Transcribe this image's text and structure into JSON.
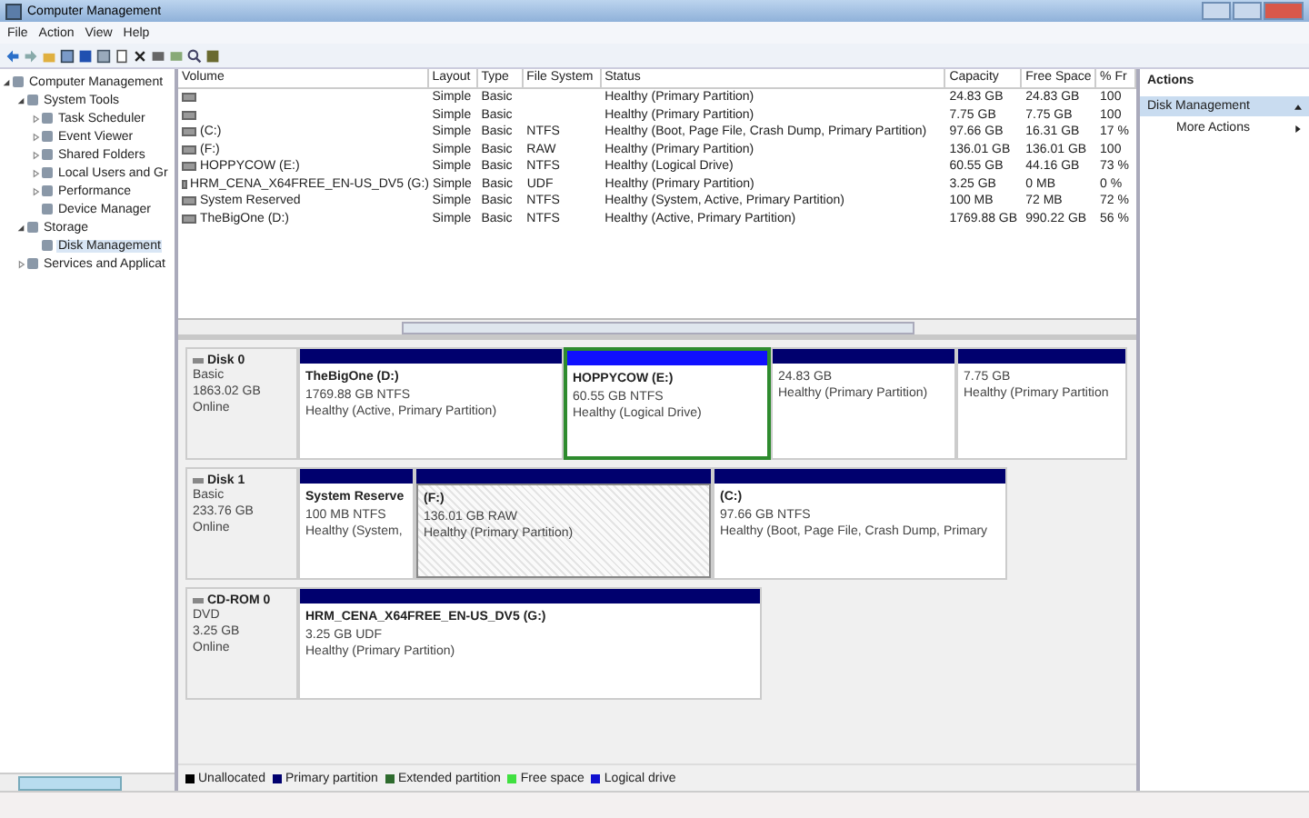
{
  "window": {
    "title": "Computer Management"
  },
  "menu": [
    "File",
    "Action",
    "View",
    "Help"
  ],
  "tree": [
    {
      "label": "Computer Management",
      "expanded": true,
      "children": [
        {
          "label": "System Tools",
          "expanded": true,
          "children": [
            {
              "label": "Task Scheduler",
              "expanded": false
            },
            {
              "label": "Event Viewer",
              "expanded": false
            },
            {
              "label": "Shared Folders",
              "expanded": false
            },
            {
              "label": "Local Users and Gr",
              "expanded": false
            },
            {
              "label": "Performance",
              "expanded": false
            },
            {
              "label": "Device Manager"
            }
          ]
        },
        {
          "label": "Storage",
          "expanded": true,
          "children": [
            {
              "label": "Disk Management",
              "selected": true
            }
          ]
        },
        {
          "label": "Services and Applicat",
          "expanded": false
        }
      ]
    }
  ],
  "volumes": {
    "columns": [
      "Volume",
      "Layout",
      "Type",
      "File System",
      "Status",
      "Capacity",
      "Free Space",
      "% Fr"
    ],
    "rows": [
      [
        "",
        "Simple",
        "Basic",
        "",
        "Healthy (Primary Partition)",
        "24.83 GB",
        "24.83 GB",
        "100"
      ],
      [
        "",
        "Simple",
        "Basic",
        "",
        "Healthy (Primary Partition)",
        "7.75 GB",
        "7.75 GB",
        "100"
      ],
      [
        "(C:)",
        "Simple",
        "Basic",
        "NTFS",
        "Healthy (Boot, Page File, Crash Dump, Primary Partition)",
        "97.66 GB",
        "16.31 GB",
        "17 %"
      ],
      [
        "(F:)",
        "Simple",
        "Basic",
        "RAW",
        "Healthy (Primary Partition)",
        "136.01 GB",
        "136.01 GB",
        "100"
      ],
      [
        "HOPPYCOW (E:)",
        "Simple",
        "Basic",
        "NTFS",
        "Healthy (Logical Drive)",
        "60.55 GB",
        "44.16 GB",
        "73 %"
      ],
      [
        "HRM_CENA_X64FREE_EN-US_DV5 (G:)",
        "Simple",
        "Basic",
        "UDF",
        "Healthy (Primary Partition)",
        "3.25 GB",
        "0 MB",
        "0 %"
      ],
      [
        "System Reserved",
        "Simple",
        "Basic",
        "NTFS",
        "Healthy (System, Active, Primary Partition)",
        "100 MB",
        "72 MB",
        "72 %"
      ],
      [
        "TheBigOne (D:)",
        "Simple",
        "Basic",
        "NTFS",
        "Healthy (Active, Primary Partition)",
        "1769.88 GB",
        "990.22 GB",
        "56 %"
      ]
    ]
  },
  "disks": [
    {
      "name": "Disk 0",
      "type": "Basic",
      "size": "1863.02 GB",
      "status": "Online",
      "partitions": [
        {
          "kind": "primary",
          "selected": false,
          "title": "TheBigOne  (D:)",
          "size": "1769.88 GB NTFS",
          "status": "Healthy (Active, Primary Partition)"
        },
        {
          "kind": "logical",
          "selected": false,
          "title": "HOPPYCOW  (E:)",
          "size": "60.55 GB NTFS",
          "status": "Healthy (Logical Drive)"
        },
        {
          "kind": "primary",
          "selected": false,
          "size": "24.83 GB",
          "status": "Healthy (Primary Partition)"
        },
        {
          "kind": "primary",
          "selected": false,
          "size": "7.75 GB",
          "status": "Healthy (Primary Partition"
        }
      ]
    },
    {
      "name": "Disk 1",
      "type": "Basic",
      "size": "233.76 GB",
      "status": "Online",
      "partitions": [
        {
          "kind": "primary",
          "selected": false,
          "title": "System Reserve",
          "size": "100 MB NTFS",
          "status": "Healthy (System,"
        },
        {
          "kind": "primary",
          "selected": true,
          "title": "(F:)",
          "size": "136.01 GB RAW",
          "status": "Healthy (Primary Partition)"
        },
        {
          "kind": "primary",
          "selected": false,
          "title": "(C:)",
          "size": "97.66 GB NTFS",
          "status": "Healthy (Boot, Page File, Crash Dump, Primary"
        }
      ]
    },
    {
      "name": "CD-ROM 0",
      "type": "DVD",
      "size": "3.25 GB",
      "status": "Online",
      "partitions": [
        {
          "kind": "primary",
          "selected": false,
          "title": "HRM_CENA_X64FREE_EN-US_DV5  (G:)",
          "size": "3.25 GB UDF",
          "status": "Healthy (Primary Partition)"
        }
      ]
    }
  ],
  "legend": [
    {
      "label": "Unallocated",
      "color": "#000000"
    },
    {
      "label": "Primary partition",
      "color": "#00006e"
    },
    {
      "label": "Extended partition",
      "color": "#2e6b2e"
    },
    {
      "label": "Free space",
      "color": "#40e040"
    },
    {
      "label": "Logical drive",
      "color": "#1010d0"
    }
  ],
  "actions": {
    "title": "Actions",
    "section": "Disk Management",
    "expanded": true,
    "items": [
      "More Actions"
    ]
  }
}
